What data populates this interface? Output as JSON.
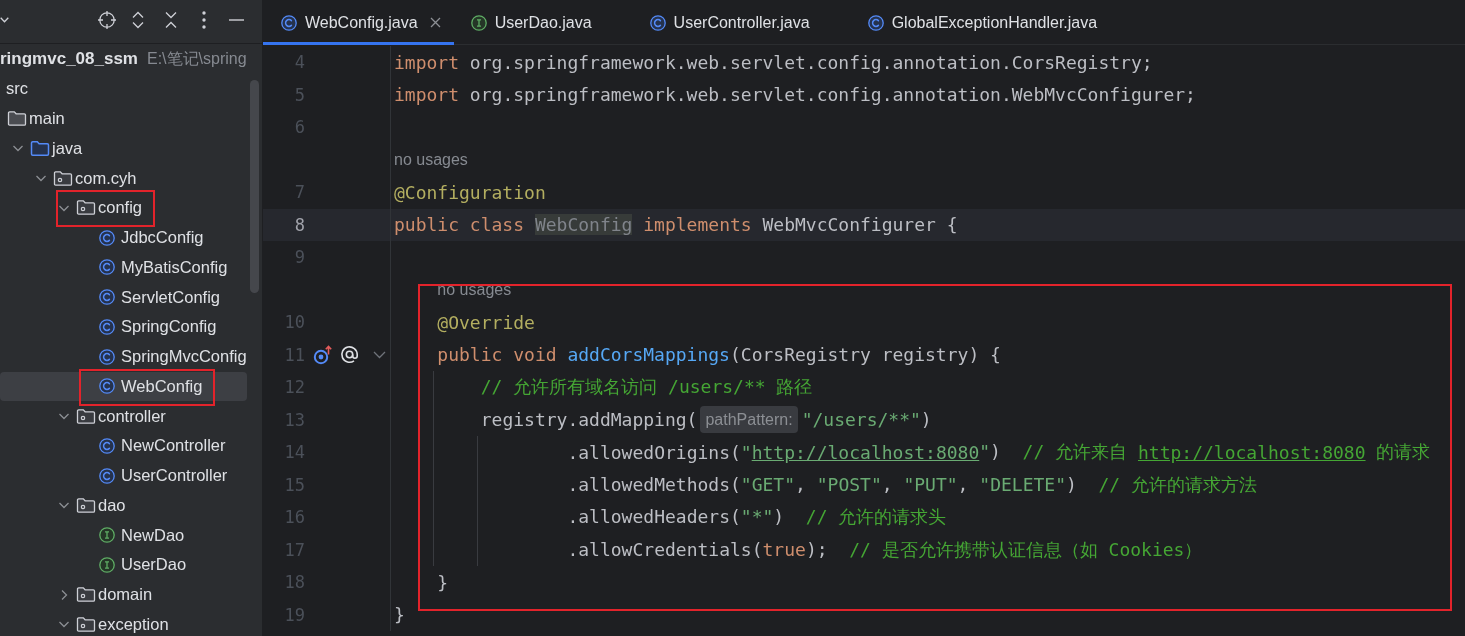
{
  "sidebar": {
    "project": {
      "name": "ringmvc_08_ssm",
      "path": "E:\\笔记\\spring"
    },
    "tree": [
      {
        "label": "src",
        "selected": false,
        "annotated": false,
        "children": [
          {
            "label": "main",
            "kind": "folder",
            "selected": false,
            "annotated": false,
            "children": [
              {
                "label": "java",
                "kind": "source-folder",
                "expanded": true,
                "selected": false,
                "annotated": false,
                "children": [
                  {
                    "label": "com.cyh",
                    "kind": "package",
                    "expanded": true,
                    "selected": false,
                    "annotated": false,
                    "children": [
                      {
                        "label": "config",
                        "kind": "package",
                        "expanded": true,
                        "selected": false,
                        "annotated": true,
                        "children": [
                          {
                            "label": "JdbcConfig",
                            "kind": "class",
                            "selected": false,
                            "annotated": false
                          },
                          {
                            "label": "MyBatisConfig",
                            "kind": "class",
                            "selected": false,
                            "annotated": false
                          },
                          {
                            "label": "ServletConfig",
                            "kind": "class",
                            "selected": false,
                            "annotated": false
                          },
                          {
                            "label": "SpringConfig",
                            "kind": "class",
                            "selected": false,
                            "annotated": false
                          },
                          {
                            "label": "SpringMvcConfig",
                            "kind": "class",
                            "selected": false,
                            "annotated": false
                          },
                          {
                            "label": "WebConfig",
                            "kind": "class",
                            "selected": true,
                            "annotated": true
                          }
                        ]
                      },
                      {
                        "label": "controller",
                        "kind": "package",
                        "expanded": true,
                        "selected": false,
                        "annotated": false,
                        "children": [
                          {
                            "label": "NewController",
                            "kind": "class",
                            "selected": false,
                            "annotated": false
                          },
                          {
                            "label": "UserController",
                            "kind": "class",
                            "selected": false,
                            "annotated": false
                          }
                        ]
                      },
                      {
                        "label": "dao",
                        "kind": "package",
                        "expanded": true,
                        "selected": false,
                        "annotated": false,
                        "children": [
                          {
                            "label": "NewDao",
                            "kind": "interface",
                            "selected": false,
                            "annotated": false
                          },
                          {
                            "label": "UserDao",
                            "kind": "interface",
                            "selected": false,
                            "annotated": false
                          }
                        ]
                      },
                      {
                        "label": "domain",
                        "kind": "package",
                        "expanded": false,
                        "selected": false,
                        "annotated": false
                      },
                      {
                        "label": "exception",
                        "kind": "package",
                        "expanded": true,
                        "selected": false,
                        "annotated": false
                      }
                    ]
                  }
                ]
              }
            ]
          }
        ]
      }
    ]
  },
  "editor": {
    "tabs": [
      {
        "label": "WebConfig.java",
        "kind": "class",
        "selected": true
      },
      {
        "label": "UserDao.java",
        "kind": "interface",
        "selected": false
      },
      {
        "label": "UserController.java",
        "kind": "class",
        "selected": false
      },
      {
        "label": "GlobalExceptionHandler.java",
        "kind": "class",
        "selected": false
      }
    ],
    "lines": [
      {
        "kind": "code",
        "number": "4",
        "current": false,
        "continuation": false,
        "tokens": [
          {
            "kind": "keyword",
            "text": "import"
          },
          {
            "kind": "plain",
            "text": " org.springframework.web.servlet.config.annotation.CorsRegistry;"
          }
        ]
      },
      {
        "kind": "code",
        "number": "5",
        "current": false,
        "continuation": false,
        "tokens": [
          {
            "kind": "keyword",
            "text": "import"
          },
          {
            "kind": "plain",
            "text": " org.springframework.web.servlet.config.annotation.WebMvcConfigurer;"
          }
        ]
      },
      {
        "kind": "code",
        "number": "6",
        "current": false
      },
      {
        "kind": "usage-hint",
        "text": "no usages",
        "current": false
      },
      {
        "kind": "code",
        "number": "7",
        "current": false,
        "continuation": false,
        "tokens": [
          {
            "kind": "annotation",
            "text": "@Configuration"
          }
        ]
      },
      {
        "kind": "code",
        "number": "8",
        "current": true,
        "continuation": false,
        "tokens": [
          {
            "kind": "keyword",
            "text": "public class "
          },
          {
            "kind": "unused",
            "text": "WebConfig"
          },
          {
            "kind": "keyword",
            "text": " implements"
          },
          {
            "kind": "plain",
            "text": " WebMvcConfigurer {"
          }
        ],
        "children": [
          {
            "kind": "code",
            "number": "9",
            "current": false
          },
          {
            "kind": "annotation",
            "children": [
              {
                "kind": "usage-hint",
                "text": "no usages",
                "current": false
              },
              {
                "kind": "code",
                "number": "10",
                "current": false,
                "continuation": false,
                "tokens": [
                  {
                    "kind": "annotation",
                    "text": "@Override"
                  }
                ]
              },
              {
                "kind": "code",
                "number": "11",
                "current": false,
                "continuation": false,
                "markers": [
                  {
                    "kind": "implements"
                  },
                  {
                    "kind": "at"
                  },
                  {
                    "kind": "fold"
                  }
                ],
                "tokens": [
                  {
                    "kind": "keyword",
                    "text": "public void "
                  },
                  {
                    "kind": "function",
                    "text": "addCorsMappings"
                  },
                  {
                    "kind": "plain",
                    "text": "(CorsRegistry registry) {"
                  }
                ],
                "children": [
                  {
                    "kind": "code",
                    "number": "12",
                    "current": false,
                    "continuation": false,
                    "tokens": [
                      {
                        "kind": "comment",
                        "text": "// 允许所有域名访问 /users/** 路径"
                      }
                    ]
                  },
                  {
                    "kind": "code",
                    "number": "13",
                    "current": false,
                    "continuation": false,
                    "tokens": [
                      {
                        "kind": "plain",
                        "text": "registry.addMapping("
                      },
                      {
                        "kind": "hint",
                        "text": "pathPattern:"
                      },
                      {
                        "kind": "string",
                        "text": "\"/users/**\""
                      },
                      {
                        "kind": "plain",
                        "text": ")"
                      }
                    ],
                    "children": [
                      {
                        "kind": "code",
                        "number": "14",
                        "current": false,
                        "continuation": true,
                        "tokens": [
                          {
                            "kind": "plain",
                            "text": ".allowedOrigins("
                          },
                          {
                            "kind": "string",
                            "text": "\""
                          },
                          {
                            "kind": "string-url",
                            "text": "http://localhost:8080"
                          },
                          {
                            "kind": "string",
                            "text": "\""
                          },
                          {
                            "kind": "plain",
                            "text": ")  "
                          },
                          {
                            "kind": "comment",
                            "text": "// 允许来自 "
                          },
                          {
                            "kind": "comment-url",
                            "text": "http://localhost:8080"
                          },
                          {
                            "kind": "comment",
                            "text": " 的请求"
                          }
                        ]
                      },
                      {
                        "kind": "code",
                        "number": "15",
                        "current": false,
                        "continuation": true,
                        "tokens": [
                          {
                            "kind": "plain",
                            "text": ".allowedMethods("
                          },
                          {
                            "kind": "string",
                            "text": "\"GET\""
                          },
                          {
                            "kind": "plain",
                            "text": ", "
                          },
                          {
                            "kind": "string",
                            "text": "\"POST\""
                          },
                          {
                            "kind": "plain",
                            "text": ", "
                          },
                          {
                            "kind": "string",
                            "text": "\"PUT\""
                          },
                          {
                            "kind": "plain",
                            "text": ", "
                          },
                          {
                            "kind": "string",
                            "text": "\"DELETE\""
                          },
                          {
                            "kind": "plain",
                            "text": ")  "
                          },
                          {
                            "kind": "comment",
                            "text": "// 允许的请求方法"
                          }
                        ]
                      },
                      {
                        "kind": "code",
                        "number": "16",
                        "current": false,
                        "continuation": true,
                        "tokens": [
                          {
                            "kind": "plain",
                            "text": ".allowedHeaders("
                          },
                          {
                            "kind": "string",
                            "text": "\"*\""
                          },
                          {
                            "kind": "plain",
                            "text": ")  "
                          },
                          {
                            "kind": "comment",
                            "text": "// 允许的请求头"
                          }
                        ]
                      },
                      {
                        "kind": "code",
                        "number": "17",
                        "current": false,
                        "continuation": true,
                        "tokens": [
                          {
                            "kind": "plain",
                            "text": ".allowCredentials("
                          },
                          {
                            "kind": "keyword",
                            "text": "true"
                          },
                          {
                            "kind": "plain",
                            "text": ");  "
                          },
                          {
                            "kind": "comment",
                            "text": "// 是否允许携带认证信息（如 Cookies）"
                          }
                        ]
                      }
                    ]
                  }
                ]
              },
              {
                "kind": "code",
                "number": "18",
                "current": false,
                "continuation": false,
                "tokens": [
                  {
                    "kind": "plain",
                    "text": "}"
                  }
                ]
              }
            ]
          }
        ]
      },
      {
        "kind": "code",
        "number": "19",
        "current": false,
        "continuation": false,
        "tokens": [
          {
            "kind": "plain",
            "text": "}"
          }
        ]
      }
    ]
  }
}
